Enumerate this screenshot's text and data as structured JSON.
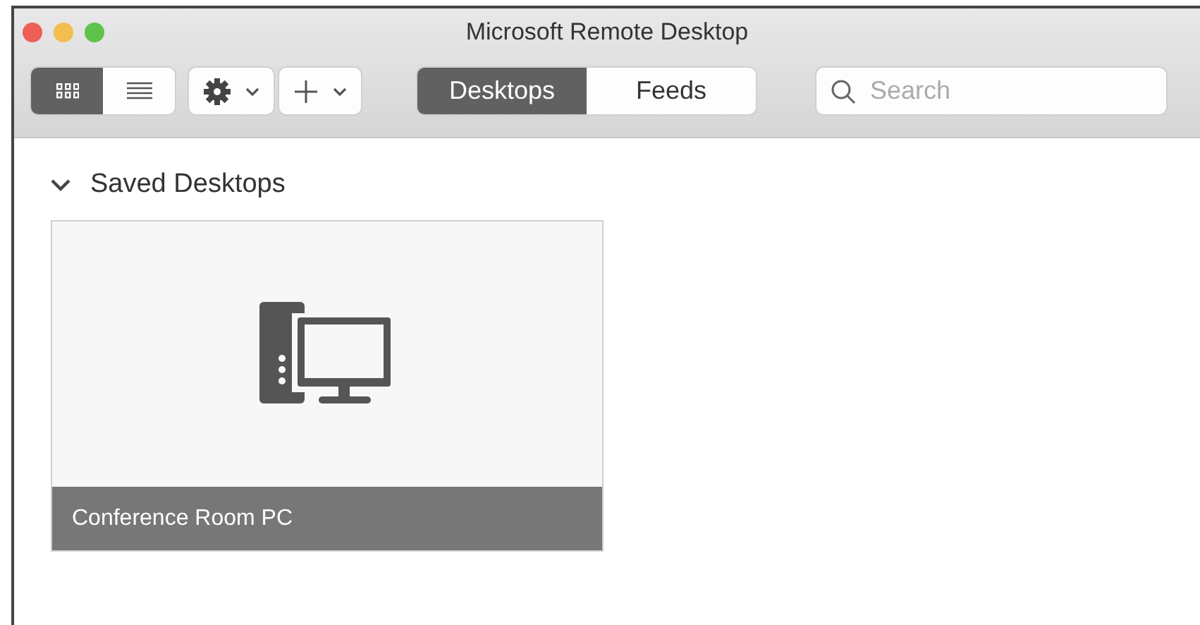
{
  "window": {
    "title": "Microsoft Remote Desktop"
  },
  "view_toggle": [
    {
      "kind": "grid",
      "selected": true
    },
    {
      "kind": "list",
      "selected": false
    }
  ],
  "segments": [
    {
      "label": "Desktops",
      "selected": true
    },
    {
      "label": "Feeds",
      "selected": false
    }
  ],
  "search": {
    "placeholder": "Search"
  },
  "section": {
    "title": "Saved Desktops",
    "expanded": true
  },
  "desktops": [
    {
      "name": "Conference Room PC"
    }
  ]
}
